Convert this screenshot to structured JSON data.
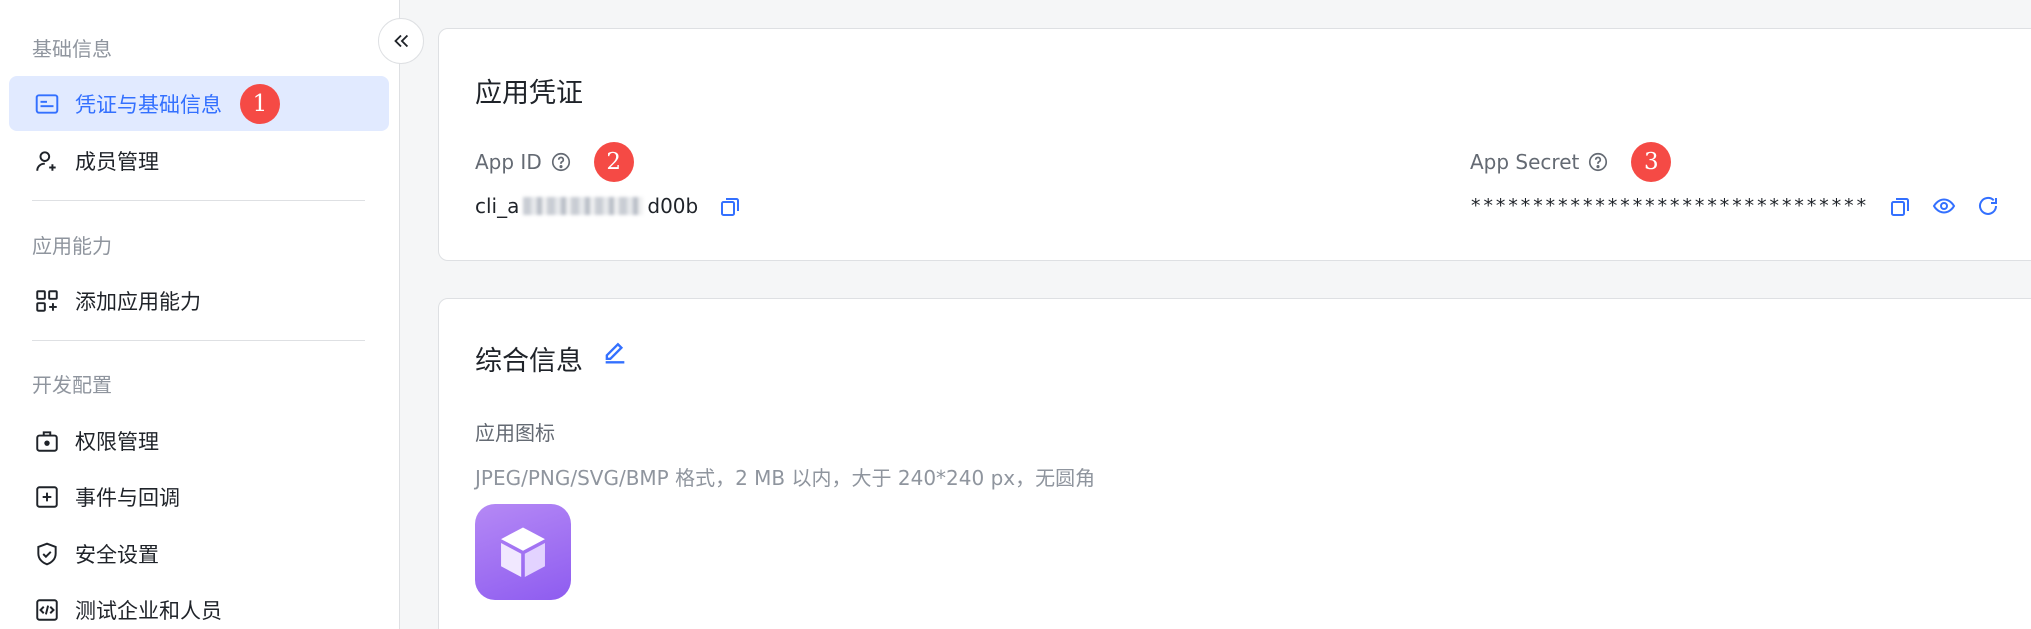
{
  "sidebar": {
    "sections": [
      {
        "title": "基础信息",
        "items": [
          {
            "label": "凭证与基础信息",
            "icon": "credential-icon",
            "active": true,
            "badge": "1"
          },
          {
            "label": "成员管理",
            "icon": "add-member-icon"
          }
        ]
      },
      {
        "title": "应用能力",
        "items": [
          {
            "label": "添加应用能力",
            "icon": "apps-add-icon"
          }
        ]
      },
      {
        "title": "开发配置",
        "items": [
          {
            "label": "权限管理",
            "icon": "permission-icon"
          },
          {
            "label": "事件与回调",
            "icon": "event-callback-icon"
          },
          {
            "label": "安全设置",
            "icon": "shield-icon"
          },
          {
            "label": "测试企业和人员",
            "icon": "code-test-icon"
          }
        ]
      }
    ],
    "collapse_icon": "double-chevron-left-icon"
  },
  "credentials": {
    "title": "应用凭证",
    "app_id": {
      "label": "App ID",
      "badge": "2",
      "value_prefix": "cli_a",
      "value_suffix": "d00b"
    },
    "app_secret": {
      "label": "App Secret",
      "badge": "3",
      "value": "********************************"
    }
  },
  "general": {
    "title": "综合信息",
    "icon_label": "应用图标",
    "icon_hint": "JPEG/PNG/SVG/BMP 格式，2 MB 以内，大于 240*240 px，无圆角"
  },
  "colors": {
    "accent": "#3370ff",
    "active_bg": "#e1eaff",
    "badge": "#f54a45",
    "app_icon": "#9b6cf2"
  }
}
